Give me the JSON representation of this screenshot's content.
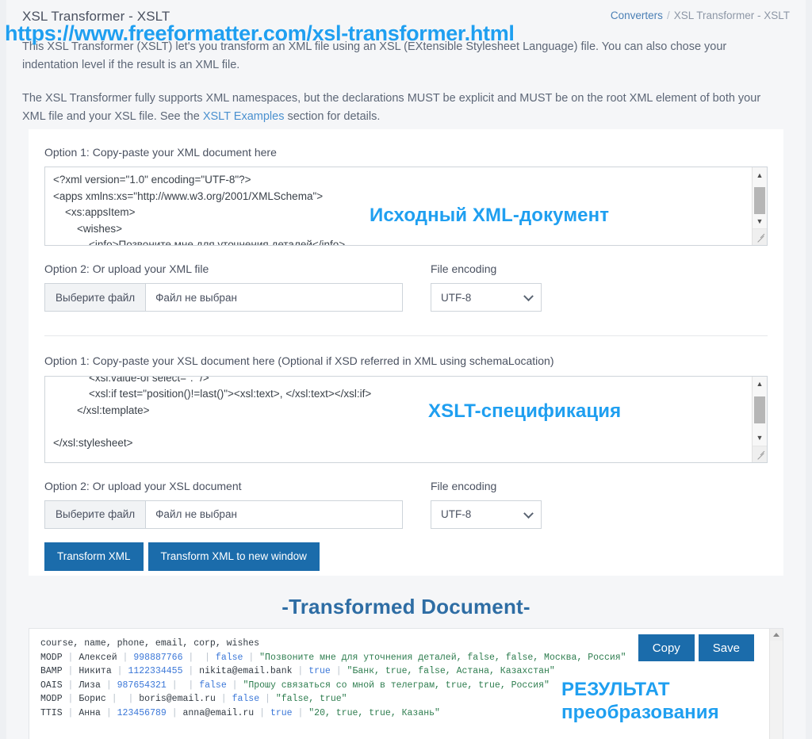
{
  "header": {
    "title": "XSL Transformer - XSLT",
    "breadcrumb_parent": "Converters",
    "breadcrumb_sep": "/",
    "breadcrumb_current": "XSL Transformer - XSLT"
  },
  "overlay": {
    "url": "https://www.freeformatter.com/xsl-transformer.html",
    "xml_label": "Исходный XML-документ",
    "xslt_label": "XSLT-спецификация",
    "result_label_line1": "РЕЗУЛЬТАТ",
    "result_label_line2": "преобразования",
    "accent_color": "#1f9ff0"
  },
  "intro": {
    "p1": "This XSL Transformer (XSLT) let's you transform an XML file using an XSL (EXtensible Stylesheet Language) file. You can also chose your indentation level if the result is an XML file.",
    "p2_before": "The XSL Transformer fully supports XML namespaces, but the declarations MUST be explicit and MUST be on the root XML element of both your XML file and your XSL file. See the ",
    "p2_link": "XSLT Examples",
    "p2_after": " section for details."
  },
  "xml_section": {
    "option1_label": "Option 1: Copy-paste your XML document here",
    "content": "<?xml version=\"1.0\" encoding=\"UTF-8\"?>\n<apps xmlns:xs=\"http://www.w3.org/2001/XMLSchema\">\n    <xs:appsItem>\n        <wishes>\n            <info>Позвоните мне для уточнения деталей</info>",
    "option2_label": "Option 2: Or upload your XML file",
    "file_button": "Выберите файл",
    "file_status": "Файл не выбран",
    "encoding_label": "File encoding",
    "encoding_value": "UTF-8"
  },
  "xsl_section": {
    "option1_label": "Option 1: Copy-paste your XSL document here (Optional if XSD referred in XML using schemaLocation)",
    "content": "            <xsl:value-of select=\". \"/>\n            <xsl:if test=\"position()!=last()\"><xsl:text>, </xsl:text></xsl:if>\n        </xsl:template>\n\n</xsl:stylesheet>",
    "option2_label": "Option 2: Or upload your XSL document",
    "file_button": "Выберите файл",
    "file_status": "Файл не выбран",
    "encoding_label": "File encoding",
    "encoding_value": "UTF-8"
  },
  "actions": {
    "transform": "Transform XML",
    "transform_new_window": "Transform XML to new window",
    "primary_color": "#1b6cab"
  },
  "result": {
    "title": "-Transformed Document-",
    "copy_label": "Copy",
    "save_label": "Save",
    "header_line": "course, name, phone, email, corp, wishes",
    "rows": [
      {
        "course": "MODP",
        "name": "Алексей",
        "phone": "998887766",
        "email": "",
        "corp": "false",
        "wishes": "\"Позвоните мне для уточнения деталей, false, false, Москва, Россия\""
      },
      {
        "course": "BAMP",
        "name": "Никита",
        "phone": "1122334455",
        "email": "nikita@email.bank",
        "corp": "true",
        "wishes": "\"Банк, true, false, Астана, Казахстан\""
      },
      {
        "course": "OAIS",
        "name": "Лиза",
        "phone": "987654321",
        "email": "",
        "corp": "false",
        "wishes": "\"Прошу связаться со мной в телеграм, true, true, Россия\""
      },
      {
        "course": "MODP",
        "name": "Борис",
        "phone": "",
        "email": "boris@email.ru",
        "corp": "false",
        "wishes": "\"false, true\""
      },
      {
        "course": "TTIS",
        "name": "Анна",
        "phone": "123456789",
        "email": "anna@email.ru",
        "corp": "true",
        "wishes": "\"20, true, true, Казань\""
      }
    ]
  }
}
